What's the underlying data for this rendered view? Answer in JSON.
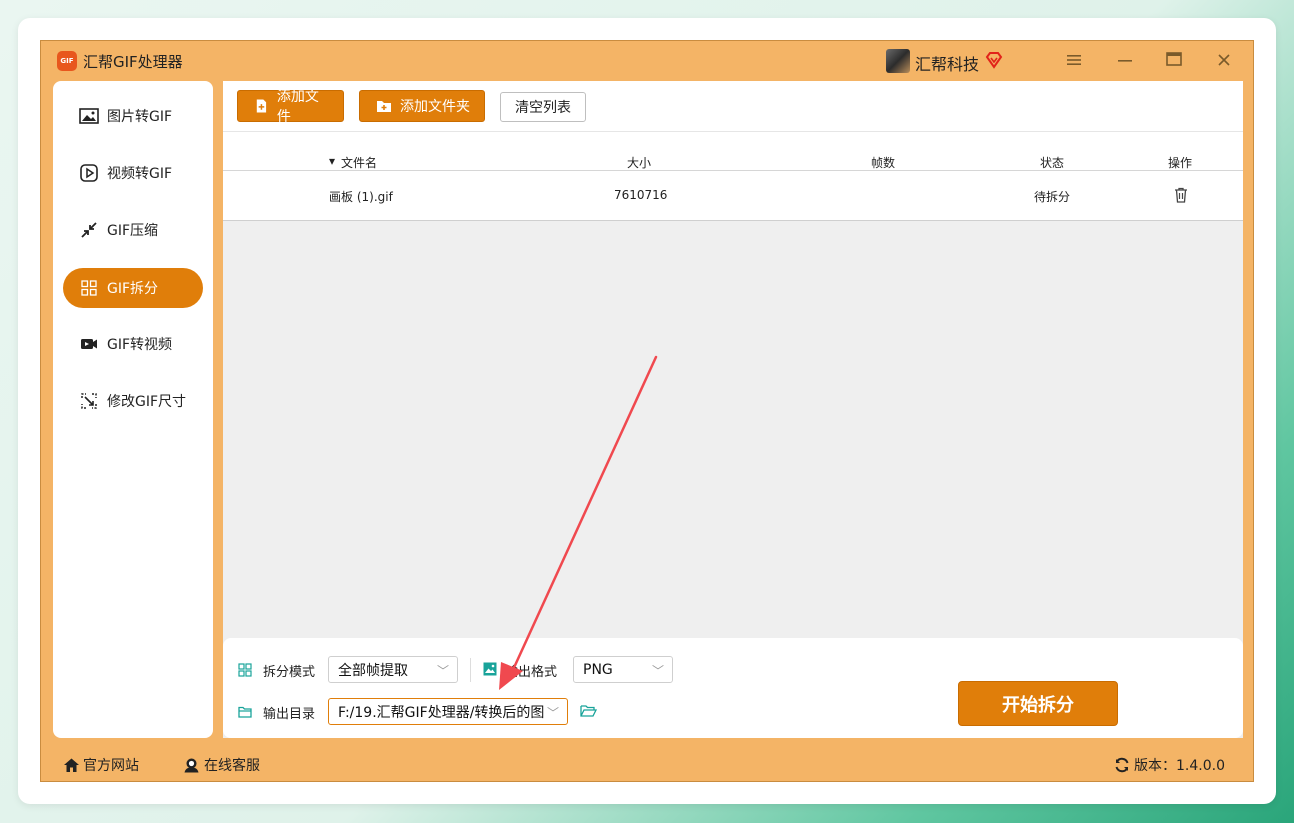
{
  "app": {
    "title": "汇帮GIF处理器",
    "logo_text": "GIF",
    "user_name": "汇帮科技",
    "accent_color": "#e07e0a",
    "frame_color": "#f4b466"
  },
  "window_controls": [
    "menu-icon",
    "minimize-icon",
    "maximize-icon",
    "close-icon"
  ],
  "sidebar": {
    "items": [
      {
        "label": "图片转GIF",
        "icon": "image-icon",
        "active": false
      },
      {
        "label": "视频转GIF",
        "icon": "play-icon",
        "active": false
      },
      {
        "label": "GIF压缩",
        "icon": "compress-icon",
        "active": false
      },
      {
        "label": "GIF拆分",
        "icon": "split-icon",
        "active": true
      },
      {
        "label": "GIF转视频",
        "icon": "video-icon",
        "active": false
      },
      {
        "label": "修改GIF尺寸",
        "icon": "resize-icon",
        "active": false
      }
    ]
  },
  "toolbar": {
    "add_file": "添加文件",
    "add_folder": "添加文件夹",
    "clear_list": "清空列表"
  },
  "table": {
    "columns": [
      "文件名",
      "大小",
      "帧数",
      "状态",
      "操作"
    ],
    "rows": [
      {
        "name": "画板 (1).gif",
        "size": "7610716",
        "frames": "",
        "status": "待拆分",
        "action": "delete-icon"
      }
    ]
  },
  "settings": {
    "split_mode_label": "拆分模式",
    "split_mode_value": "全部帧提取",
    "output_format_label": "输出格式",
    "output_format_value": "PNG",
    "output_dir_label": "输出目录",
    "output_dir_value": "F:/19.汇帮GIF处理器/转换后的图"
  },
  "start_button": "开始拆分",
  "footer": {
    "website": "官方网站",
    "support": "在线客服",
    "version": "版本：1.4.0.0"
  }
}
